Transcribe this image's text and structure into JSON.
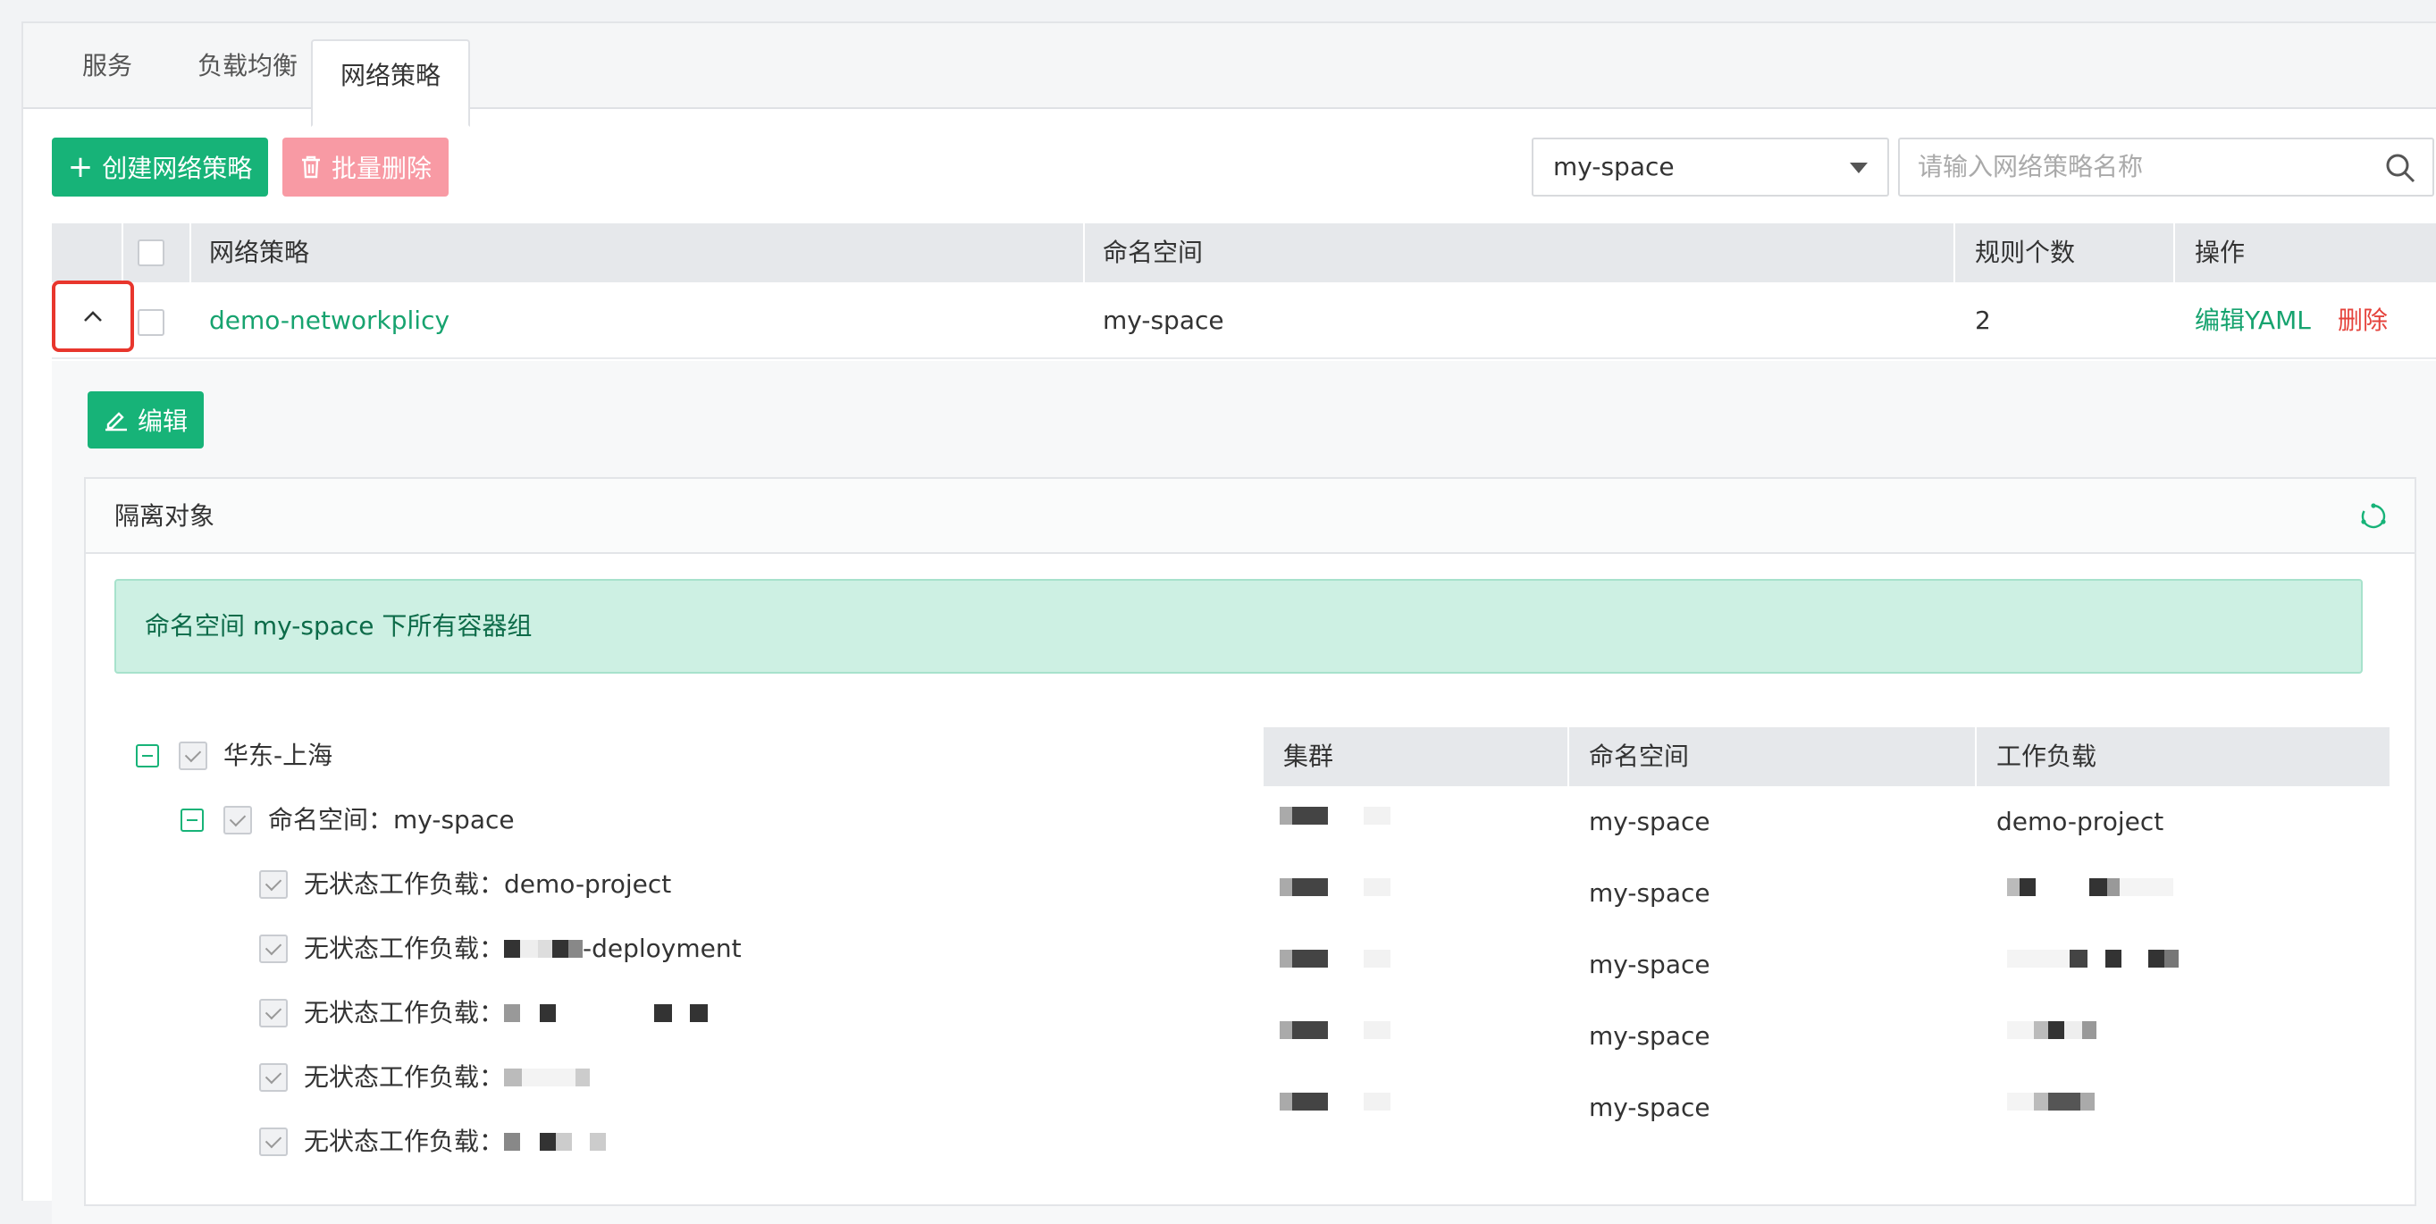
{
  "tabs": [
    {
      "label": "服务",
      "active": false
    },
    {
      "label": "负载均衡",
      "active": false
    },
    {
      "label": "网络策略",
      "active": true
    }
  ],
  "toolbar": {
    "create_label": "创建网络策略",
    "batch_delete_label": "批量删除",
    "namespace_selected": "my-space",
    "search_placeholder": "请输入网络策略名称"
  },
  "table": {
    "headers": [
      "网络策略",
      "命名空间",
      "规则个数",
      "操作"
    ],
    "rows": [
      {
        "name": "demo-networkplicy",
        "namespace": "my-space",
        "rule_count": "2",
        "edit_yaml": "编辑YAML",
        "delete": "删除"
      }
    ]
  },
  "detail": {
    "edit_label": "编辑",
    "section_title": "隔离对象",
    "alert_text": "命名空间 my-space 下所有容器组",
    "tree": {
      "region": "华东-上海",
      "namespace": "命名空间：my-space",
      "workloads": [
        {
          "label": "无状态工作负载：",
          "name": "demo-project"
        },
        {
          "label": "无状态工作负载：",
          "name": "-deployment"
        },
        {
          "label": "无状态工作负载：",
          "name": ""
        },
        {
          "label": "无状态工作负载：",
          "name": ""
        },
        {
          "label": "无状态工作负载：",
          "name": ""
        }
      ]
    },
    "right_table": {
      "headers": [
        "集群",
        "命名空间",
        "工作负载"
      ],
      "rows": [
        {
          "namespace": "my-space",
          "workload": "demo-project"
        },
        {
          "namespace": "my-space",
          "workload": ""
        },
        {
          "namespace": "my-space",
          "workload": ""
        },
        {
          "namespace": "my-space",
          "workload": ""
        },
        {
          "namespace": "my-space",
          "workload": ""
        }
      ]
    }
  },
  "colors": {
    "primary": "#17b378",
    "danger": "#e5443d",
    "highlight_border": "#e8362d",
    "alert_bg": "#cdf0e3"
  }
}
